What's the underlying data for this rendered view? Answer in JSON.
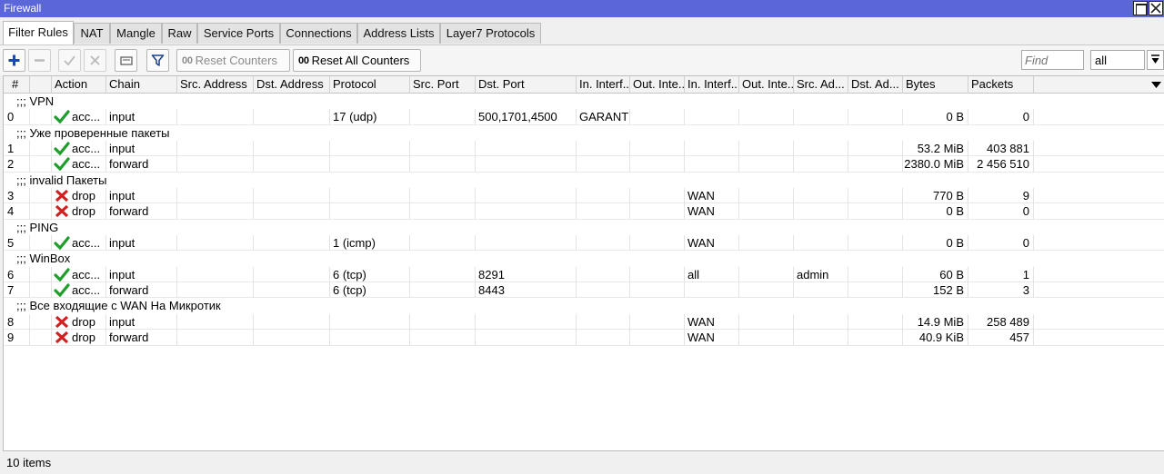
{
  "window": {
    "title": "Firewall"
  },
  "tabs": [
    {
      "label": "Filter Rules",
      "active": true
    },
    {
      "label": "NAT"
    },
    {
      "label": "Mangle"
    },
    {
      "label": "Raw"
    },
    {
      "label": "Service Ports"
    },
    {
      "label": "Connections"
    },
    {
      "label": "Address Lists"
    },
    {
      "label": "Layer7 Protocols"
    }
  ],
  "toolbar": {
    "icons": [
      "add-icon",
      "remove-icon",
      "enable-icon",
      "disable-icon",
      "comment-icon",
      "filter-icon"
    ],
    "reset_counters_badge": "00",
    "reset_counters_label": "Reset Counters",
    "reset_all_badge": "00",
    "reset_all_label": "Reset All Counters",
    "find_placeholder": "Find",
    "filter_value": "all"
  },
  "columns": [
    "#",
    "Action",
    "Chain",
    "Src. Address",
    "Dst. Address",
    "Protocol",
    "Src. Port",
    "Dst. Port",
    "In. Interf...",
    "Out. Inte...",
    "In. Interf...",
    "Out. Inte...",
    "Src. Ad...",
    "Dst. Ad...",
    "Bytes",
    "Packets"
  ],
  "rows": [
    {
      "comment": ";;; VPN"
    },
    {
      "num": "0",
      "action": "acc...",
      "action_type": "accept",
      "chain": "input",
      "protocol": "17 (udp)",
      "dst_port": "500,1701,4500",
      "in_if": "GARANT",
      "in_if_list": "",
      "src_addr_list": "",
      "bytes": "0 B",
      "packets": "0"
    },
    {
      "comment": ";;; Уже проверенные пакеты"
    },
    {
      "num": "1",
      "action": "acc...",
      "action_type": "accept",
      "chain": "input",
      "protocol": "",
      "dst_port": "",
      "in_if": "",
      "in_if_list": "",
      "src_addr_list": "",
      "bytes": "53.2 MiB",
      "packets": "403 881"
    },
    {
      "num": "2",
      "action": "acc...",
      "action_type": "accept",
      "chain": "forward",
      "protocol": "",
      "dst_port": "",
      "in_if": "",
      "in_if_list": "",
      "src_addr_list": "",
      "bytes": "2380.0 MiB",
      "packets": "2 456 510"
    },
    {
      "comment": ";;; invalid Пакеты"
    },
    {
      "num": "3",
      "action": "drop",
      "action_type": "drop",
      "chain": "input",
      "protocol": "",
      "dst_port": "",
      "in_if": "",
      "in_if_list": "WAN",
      "src_addr_list": "",
      "bytes": "770 B",
      "packets": "9"
    },
    {
      "num": "4",
      "action": "drop",
      "action_type": "drop",
      "chain": "forward",
      "protocol": "",
      "dst_port": "",
      "in_if": "",
      "in_if_list": "WAN",
      "src_addr_list": "",
      "bytes": "0 B",
      "packets": "0"
    },
    {
      "comment": ";;; PING"
    },
    {
      "num": "5",
      "action": "acc...",
      "action_type": "accept",
      "chain": "input",
      "protocol": "1 (icmp)",
      "dst_port": "",
      "in_if": "",
      "in_if_list": "WAN",
      "src_addr_list": "",
      "bytes": "0 B",
      "packets": "0"
    },
    {
      "comment": ";;; WinBox"
    },
    {
      "num": "6",
      "action": "acc...",
      "action_type": "accept",
      "chain": "input",
      "protocol": "6 (tcp)",
      "dst_port": "8291",
      "in_if": "",
      "in_if_list": "all",
      "src_addr_list": "admin",
      "bytes": "60 B",
      "packets": "1"
    },
    {
      "num": "7",
      "action": "acc...",
      "action_type": "accept",
      "chain": "forward",
      "protocol": "6 (tcp)",
      "dst_port": "8443",
      "in_if": "",
      "in_if_list": "",
      "src_addr_list": "",
      "bytes": "152 B",
      "packets": "3"
    },
    {
      "comment": ";;; Все входящие с WAN На Микротик"
    },
    {
      "num": "8",
      "action": "drop",
      "action_type": "drop",
      "chain": "input",
      "protocol": "",
      "dst_port": "",
      "in_if": "",
      "in_if_list": "WAN",
      "src_addr_list": "",
      "bytes": "14.9 MiB",
      "packets": "258 489"
    },
    {
      "num": "9",
      "action": "drop",
      "action_type": "drop",
      "chain": "forward",
      "protocol": "",
      "dst_port": "",
      "in_if": "",
      "in_if_list": "WAN",
      "src_addr_list": "",
      "bytes": "40.9 KiB",
      "packets": "457"
    }
  ],
  "status": {
    "items": "10 items"
  },
  "colors": {
    "titlebar": "#5b67d8",
    "accept": "#1f9e2c",
    "drop": "#d21f1f",
    "add": "#1a47b8"
  }
}
